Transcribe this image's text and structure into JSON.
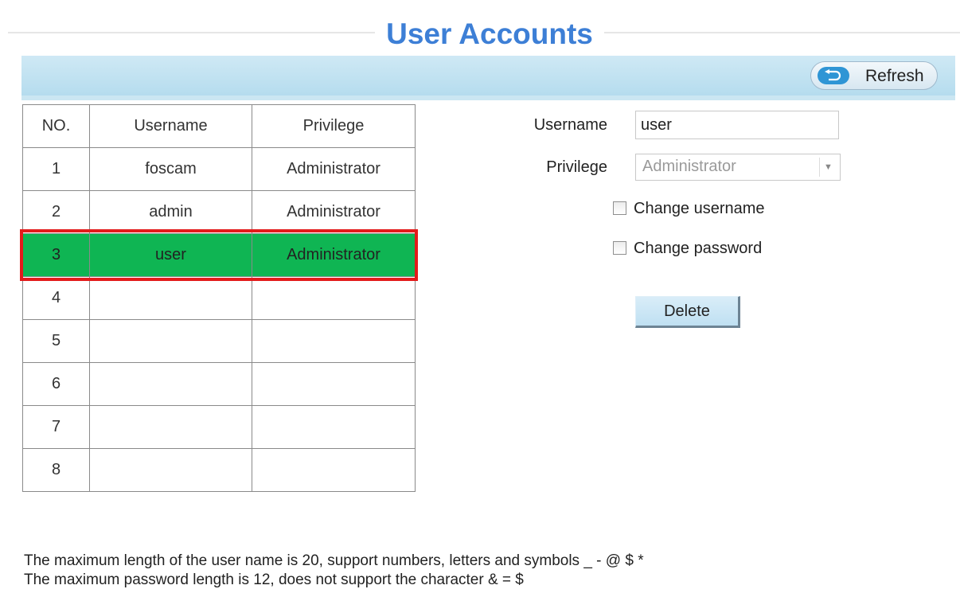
{
  "header": {
    "title": "User Accounts",
    "refresh_label": "Refresh"
  },
  "table": {
    "columns": [
      "NO.",
      "Username",
      "Privilege"
    ],
    "rows": [
      {
        "no": "1",
        "username": "foscam",
        "privilege": "Administrator"
      },
      {
        "no": "2",
        "username": "admin",
        "privilege": "Administrator"
      },
      {
        "no": "3",
        "username": "user",
        "privilege": "Administrator"
      },
      {
        "no": "4",
        "username": "",
        "privilege": ""
      },
      {
        "no": "5",
        "username": "",
        "privilege": ""
      },
      {
        "no": "6",
        "username": "",
        "privilege": ""
      },
      {
        "no": "7",
        "username": "",
        "privilege": ""
      },
      {
        "no": "8",
        "username": "",
        "privilege": ""
      }
    ],
    "selected_row": 3
  },
  "form": {
    "username_label": "Username",
    "username_value": "user",
    "privilege_label": "Privilege",
    "privilege_value": "Administrator",
    "change_username_label": "Change username",
    "change_username_checked": false,
    "change_password_label": "Change password",
    "change_password_checked": false,
    "delete_label": "Delete"
  },
  "notes": {
    "line1": "The maximum length of the user name is 20, support numbers, letters and symbols _ - @ $ *",
    "line2": "The maximum password length is 12, does not support the character & = $"
  },
  "colors": {
    "title": "#3d7fd6",
    "selected_row": "#0fb553",
    "highlight_border": "#e31b1b",
    "toolbar": "#b5dcee",
    "refresh_icon": "#2f95d5"
  },
  "icons": {
    "refresh": "refresh-arrow-icon",
    "select_arrow": "chevron-down-icon"
  }
}
